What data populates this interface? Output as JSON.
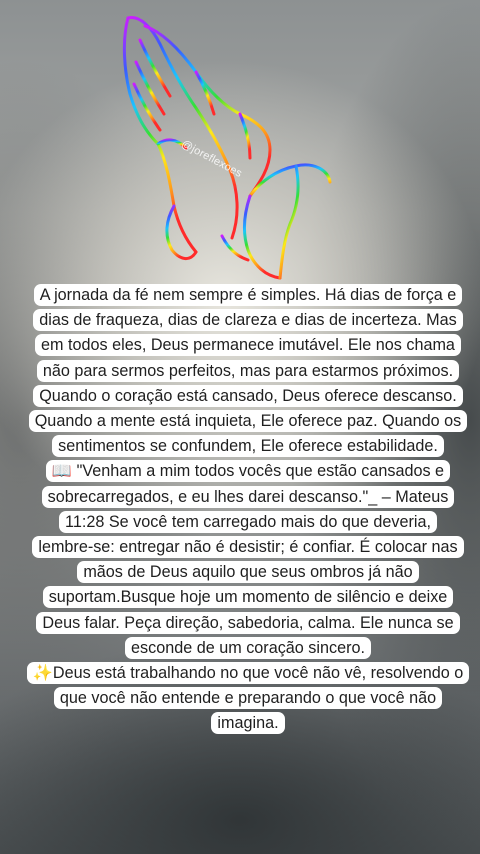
{
  "watermark": "@joreflexoes",
  "post": {
    "lines": [
      "A jornada da fé nem sempre é simples. Há dias de força e",
      "dias de fraqueza, dias de clareza e dias de incerteza. Mas",
      "em todos eles, Deus permanece imutável. Ele nos chama",
      "não para sermos perfeitos, mas para estarmos próximos.",
      "Quando o coração está cansado, Deus oferece descanso.",
      "Quando a mente está inquieta, Ele oferece paz. Quando os",
      "sentimentos se confundem, Ele oferece estabilidade.",
      "📖 \"Venham a mim todos vocês que estão cansados e",
      "sobrecarregados, e eu lhes darei descanso.\"_ – Mateus",
      "11:28 Se você tem carregado mais do que deveria,",
      "lembre-se: entregar não é desistir; é confiar. É colocar nas",
      "mãos de Deus aquilo que seus ombros já não",
      "suportam.Busque hoje um momento de silêncio e deixe",
      "Deus falar. Peça direção, sabedoria, calma. Ele nunca se",
      "esconde de um coração sincero.",
      "✨Deus está trabalhando no que você não vê, resolvendo o",
      "que você não entende e preparando o que você não",
      "imagina."
    ]
  },
  "colors": {
    "hands_gradient": [
      "#ff2b2b",
      "#ff9f1a",
      "#ffe81a",
      "#35e035",
      "#1ac6ff",
      "#3b5bff",
      "#d21bff"
    ],
    "text": "#1f1f1f",
    "highlight": "#ffffff"
  }
}
